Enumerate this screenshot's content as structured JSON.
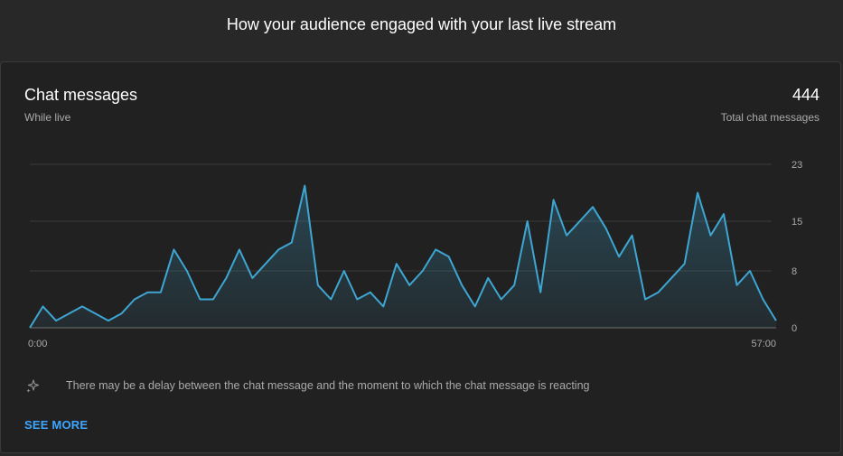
{
  "header": {
    "title": "How your audience engaged with your last live stream"
  },
  "card": {
    "title": "Chat messages",
    "subtitle": "While live",
    "total_value": "444",
    "total_label": "Total chat messages",
    "notice": "There may be a delay between the chat message and the moment to which the chat message is reacting",
    "notice_icon": "sparkle-icon",
    "see_more": "SEE MORE"
  },
  "colors": {
    "line": "#3ea6d3",
    "link": "#3ea6ff"
  },
  "chart_data": {
    "type": "area",
    "title": "",
    "xlabel": "",
    "ylabel": "",
    "x_tick_labels": [
      "0:00",
      "57:00"
    ],
    "y_ticks": [
      0,
      8,
      15,
      23
    ],
    "ylim": [
      0,
      23
    ],
    "grid": true,
    "series": [
      {
        "values": [
          0,
          3,
          1,
          2,
          3,
          2,
          1,
          2,
          4,
          5,
          5,
          11,
          8,
          4,
          4,
          7,
          11,
          7,
          9,
          11,
          12,
          20,
          6,
          4,
          8,
          4,
          5,
          3,
          9,
          6,
          8,
          11,
          10,
          6,
          3,
          7,
          4,
          6,
          15,
          5,
          18,
          13,
          15,
          17,
          14,
          10,
          13,
          4,
          5,
          7,
          9,
          19,
          13,
          16,
          6,
          8,
          4,
          1
        ]
      }
    ]
  }
}
